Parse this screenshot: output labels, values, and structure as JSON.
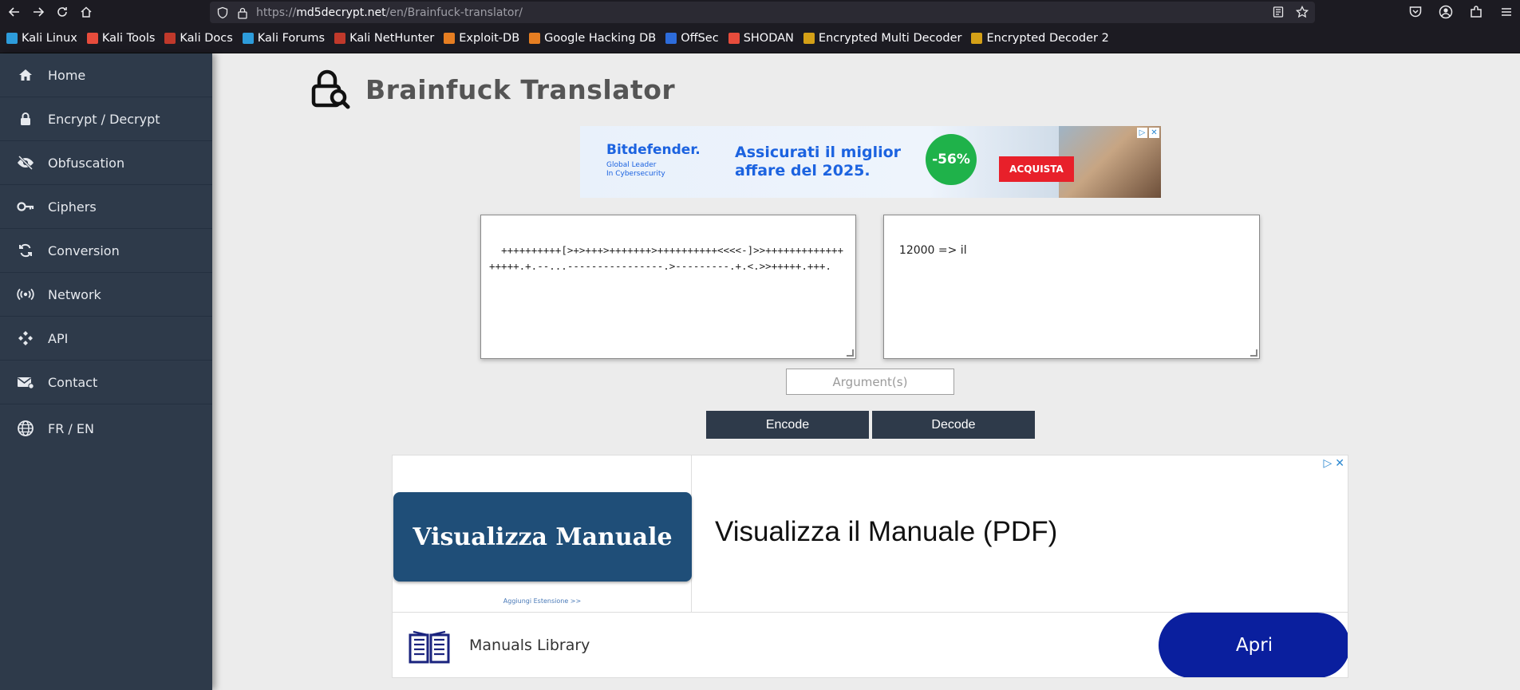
{
  "browser": {
    "url_prefix": "https://",
    "url_domain": "md5decrypt.net",
    "url_path": "/en/Brainfuck-translator/"
  },
  "bookmarks": [
    {
      "label": "Kali Linux",
      "color": "#2d9cdb"
    },
    {
      "label": "Kali Tools",
      "color": "#e74c3c"
    },
    {
      "label": "Kali Docs",
      "color": "#c0392b"
    },
    {
      "label": "Kali Forums",
      "color": "#2d9cdb"
    },
    {
      "label": "Kali NetHunter",
      "color": "#c0392b"
    },
    {
      "label": "Exploit-DB",
      "color": "#e67e22"
    },
    {
      "label": "Google Hacking DB",
      "color": "#e67e22"
    },
    {
      "label": "OffSec",
      "color": "#2d6cdb"
    },
    {
      "label": "SHODAN",
      "color": "#e74c3c"
    },
    {
      "label": "Encrypted Multi Decoder",
      "color": "#d4a017"
    },
    {
      "label": "Encrypted Decoder 2",
      "color": "#d4a017"
    }
  ],
  "sidebar": {
    "items": [
      {
        "label": "Home",
        "icon": "home-icon"
      },
      {
        "label": "Encrypt / Decrypt",
        "icon": "lock-icon"
      },
      {
        "label": "Obfuscation",
        "icon": "eye-slash-icon"
      },
      {
        "label": "Ciphers",
        "icon": "key-icon"
      },
      {
        "label": "Conversion",
        "icon": "refresh-icon"
      },
      {
        "label": "Network",
        "icon": "broadcast-icon"
      },
      {
        "label": "API",
        "icon": "api-icon"
      },
      {
        "label": "Contact",
        "icon": "mail-icon"
      },
      {
        "label": "FR / EN",
        "icon": "globe-icon"
      }
    ]
  },
  "main": {
    "title": "Brainfuck Translator",
    "input_text": "++++++++++[>+>+++>+++++++>++++++++++<<<<-]>>++++++++++++++++++.+.--...----------------.>---------.+.<.>>+++++.+++.",
    "output_text": "12000 => il",
    "argument_placeholder": "Argument(s)",
    "encode_label": "Encode",
    "decode_label": "Decode"
  },
  "ad_top": {
    "brand": "Bitdefender.",
    "tagline_1": "Global Leader",
    "tagline_2": "In Cybersecurity",
    "headline_1": "Assicurati il miglior",
    "headline_2": "affare del 2025.",
    "discount": "-56%",
    "cta": "ACQUISTA"
  },
  "ad_bottom": {
    "button_text": "Visualizza Manuale",
    "extension_text": "Aggiungi Estensione >>",
    "headline": "Visualizza il Manuale (PDF)",
    "brand": "Manuals Library",
    "cta": "Apri"
  }
}
